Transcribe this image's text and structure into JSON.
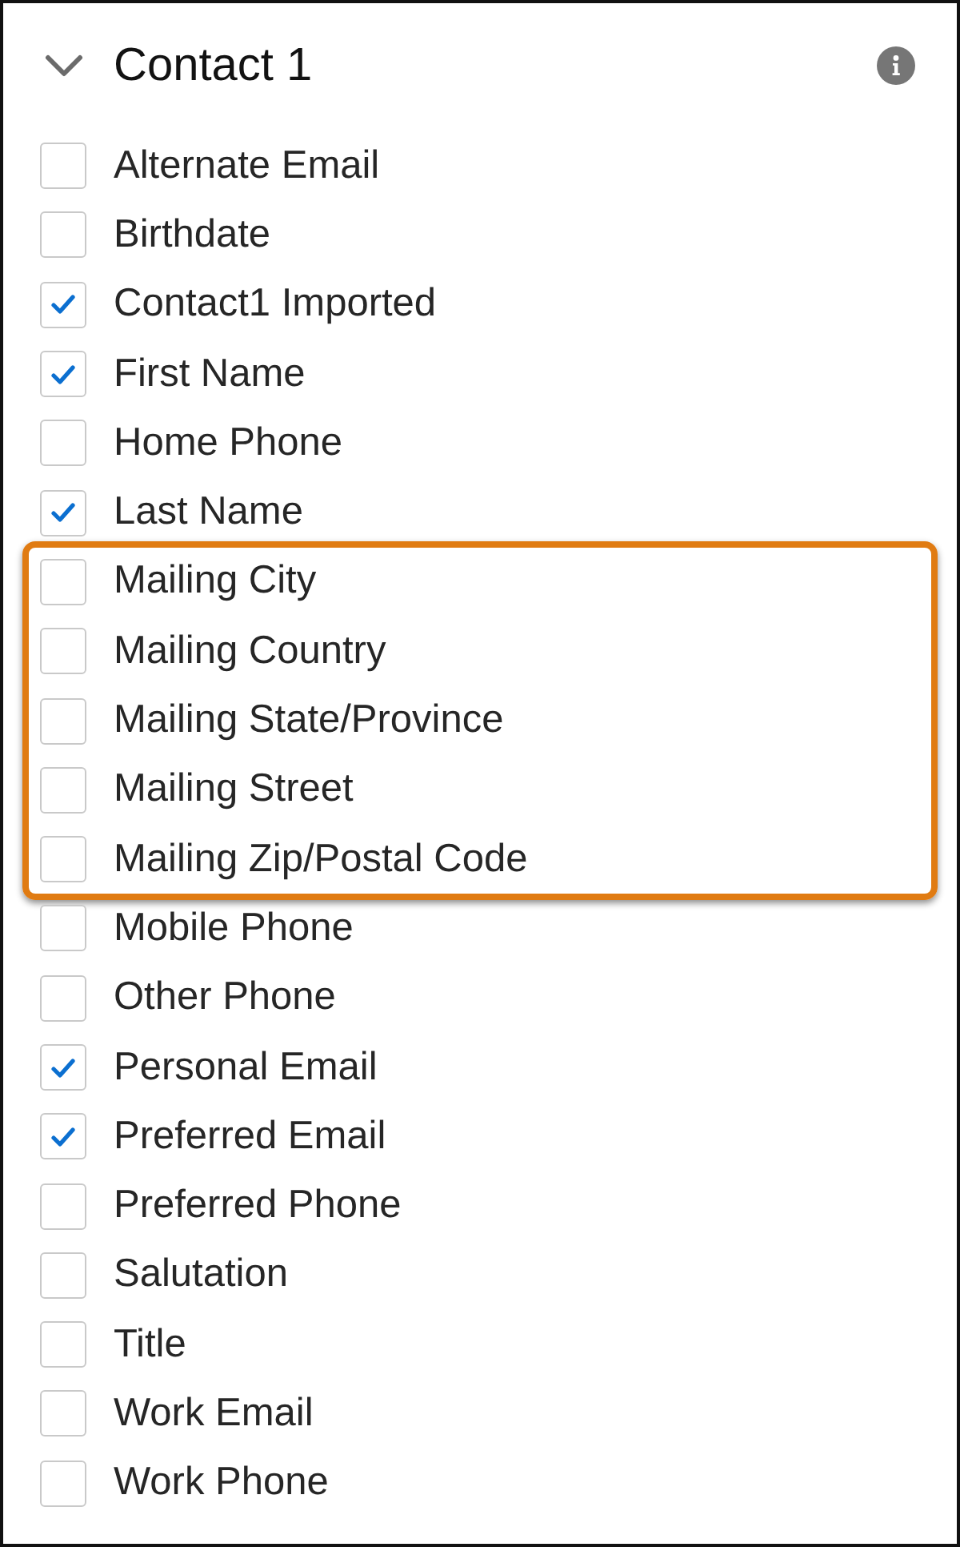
{
  "section": {
    "title": "Contact 1",
    "expanded": true
  },
  "fields": [
    {
      "label": "Alternate Email",
      "checked": false,
      "highlighted": false
    },
    {
      "label": "Birthdate",
      "checked": false,
      "highlighted": false
    },
    {
      "label": "Contact1 Imported",
      "checked": true,
      "highlighted": false
    },
    {
      "label": "First Name",
      "checked": true,
      "highlighted": false
    },
    {
      "label": "Home Phone",
      "checked": false,
      "highlighted": false
    },
    {
      "label": "Last Name",
      "checked": true,
      "highlighted": false
    },
    {
      "label": "Mailing City",
      "checked": false,
      "highlighted": true
    },
    {
      "label": "Mailing Country",
      "checked": false,
      "highlighted": true
    },
    {
      "label": "Mailing State/Province",
      "checked": false,
      "highlighted": true
    },
    {
      "label": "Mailing Street",
      "checked": false,
      "highlighted": true
    },
    {
      "label": "Mailing Zip/Postal Code",
      "checked": false,
      "highlighted": true
    },
    {
      "label": "Mobile Phone",
      "checked": false,
      "highlighted": false
    },
    {
      "label": "Other Phone",
      "checked": false,
      "highlighted": false
    },
    {
      "label": "Personal Email",
      "checked": true,
      "highlighted": false
    },
    {
      "label": "Preferred Email",
      "checked": true,
      "highlighted": false
    },
    {
      "label": "Preferred Phone",
      "checked": false,
      "highlighted": false
    },
    {
      "label": "Salutation",
      "checked": false,
      "highlighted": false
    },
    {
      "label": "Title",
      "checked": false,
      "highlighted": false
    },
    {
      "label": "Work Email",
      "checked": false,
      "highlighted": false
    },
    {
      "label": "Work Phone",
      "checked": false,
      "highlighted": false
    }
  ]
}
